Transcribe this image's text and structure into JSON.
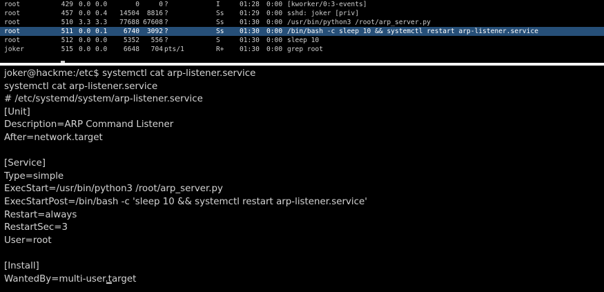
{
  "ps_rows": [
    {
      "user": "root",
      "pid": "429",
      "cpu": "0.0",
      "mem": "0.0",
      "vsz": "0",
      "rss": "0",
      "tty": "?",
      "stat": "I",
      "start": "01:28",
      "time": "0:00",
      "command": "[kworker/0:3-events]",
      "highlighted": false
    },
    {
      "user": "root",
      "pid": "457",
      "cpu": "0.0",
      "mem": "0.4",
      "vsz": "14504",
      "rss": "8816",
      "tty": "?",
      "stat": "Ss",
      "start": "01:29",
      "time": "0:00",
      "command": "sshd: joker [priv]",
      "highlighted": false
    },
    {
      "user": "root",
      "pid": "510",
      "cpu": "3.3",
      "mem": "3.3",
      "vsz": "77688",
      "rss": "67608",
      "tty": "?",
      "stat": "Ss",
      "start": "01:30",
      "time": "0:00",
      "command": "/usr/bin/python3 /root/arp_server.py",
      "highlighted": false
    },
    {
      "user": "root",
      "pid": "511",
      "cpu": "0.0",
      "mem": "0.1",
      "vsz": "6740",
      "rss": "3092",
      "tty": "?",
      "stat": "Ss",
      "start": "01:30",
      "time": "0:00",
      "command": "/bin/bash -c sleep 10 && systemctl restart arp-listener.service",
      "highlighted": true
    },
    {
      "user": "root",
      "pid": "512",
      "cpu": "0.0",
      "mem": "0.0",
      "vsz": "5352",
      "rss": "556",
      "tty": "?",
      "stat": "S",
      "start": "01:30",
      "time": "0:00",
      "command": "sleep 10",
      "highlighted": false
    },
    {
      "user": "joker",
      "pid": "515",
      "cpu": "0.0",
      "mem": "0.0",
      "vsz": "6648",
      "rss": "704",
      "tty": "pts/1",
      "stat": "R+",
      "start": "01:30",
      "time": "0:00",
      "command": "grep root",
      "highlighted": false
    }
  ],
  "terminal_lines": [
    "joker@hackme:/etc$ systemctl cat arp-listener.service",
    "systemctl cat arp-listener.service",
    "# /etc/systemd/system/arp-listener.service",
    "[Unit]",
    "Description=ARP Command Listener",
    "After=network.target",
    "",
    "[Service]",
    "Type=simple",
    "ExecStart=/usr/bin/python3 /root/arp_server.py",
    "ExecStartPost=/bin/bash -c 'sleep 10 && systemctl restart arp-listener.service'",
    "Restart=always",
    "RestartSec=3",
    "User=root",
    "",
    "[Install]",
    "WantedBy=multi-user.target"
  ],
  "colors": {
    "background": "#000000",
    "text": "#d4d4d4",
    "selection": "#264f78"
  }
}
